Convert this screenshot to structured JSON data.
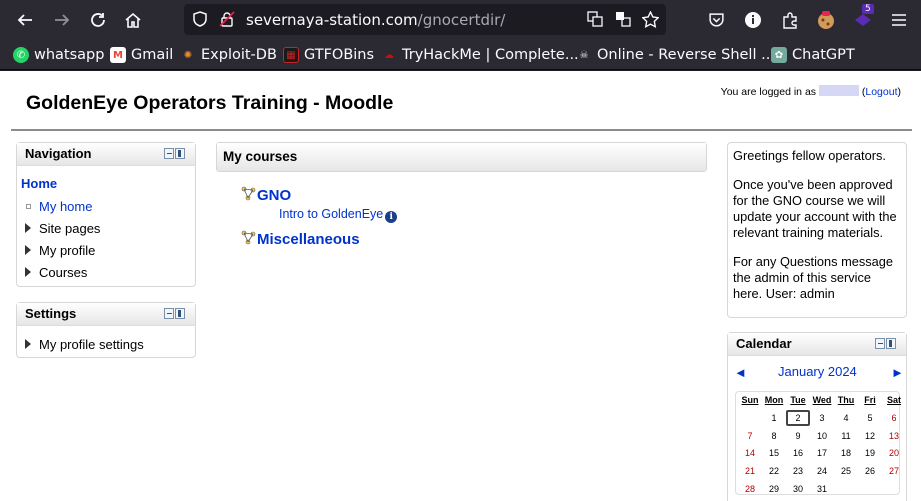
{
  "browser": {
    "url_host": "severnaya-station.com",
    "url_path": "/gnocertdir/",
    "notification_badge": "5"
  },
  "bookmarks": [
    {
      "label": "whatsapp",
      "icon": "whatsapp-icon"
    },
    {
      "label": "Gmail",
      "icon": "gmail-icon"
    },
    {
      "label": "Exploit-DB",
      "icon": "exploit-db-icon"
    },
    {
      "label": "GTFOBins",
      "icon": "gtfobins-icon"
    },
    {
      "label": "TryHackMe | Complete...",
      "icon": "tryhackme-icon"
    },
    {
      "label": "Online - Reverse Shell ...",
      "icon": "skull-icon"
    },
    {
      "label": "ChatGPT",
      "icon": "chatgpt-icon"
    }
  ],
  "header": {
    "site_title": "GoldenEye Operators Training - Moodle",
    "logged_in_prefix": "You are logged in as",
    "logout_open": "(",
    "logout_label": "Logout",
    "logout_close": ")"
  },
  "navigation": {
    "title": "Navigation",
    "home": "Home",
    "items": [
      "My home",
      "Site pages",
      "My profile",
      "Courses"
    ]
  },
  "settings": {
    "title": "Settings",
    "items": [
      "My profile settings"
    ]
  },
  "my_courses": {
    "title": "My courses",
    "courses": [
      {
        "name": "GNO",
        "sub": "Intro to GoldenEye"
      },
      {
        "name": "Miscellaneous"
      }
    ]
  },
  "greeting": {
    "p1": "Greetings fellow operators.",
    "p2": "Once you've been approved for the GNO course we will update your account with the relevant training materials.",
    "p3": "For any Questions message the admin of this service here. User: admin"
  },
  "calendar": {
    "title": "Calendar",
    "prev": "◄",
    "next": "►",
    "month": "January 2024",
    "weekdays": [
      "Sun",
      "Mon",
      "Tue",
      "Wed",
      "Thu",
      "Fri",
      "Sat"
    ],
    "weeks": [
      [
        "",
        "1",
        "2",
        "3",
        "4",
        "5",
        "6"
      ],
      [
        "7",
        "8",
        "9",
        "10",
        "11",
        "12",
        "13"
      ],
      [
        "14",
        "15",
        "16",
        "17",
        "18",
        "19",
        "20"
      ],
      [
        "21",
        "22",
        "23",
        "24",
        "25",
        "26",
        "27"
      ],
      [
        "28",
        "29",
        "30",
        "31",
        "",
        "",
        ""
      ]
    ],
    "today": "2"
  },
  "colors": {
    "link": "#0033cc",
    "weekend": "#b10000",
    "browser_bg": "#2b2a33"
  }
}
